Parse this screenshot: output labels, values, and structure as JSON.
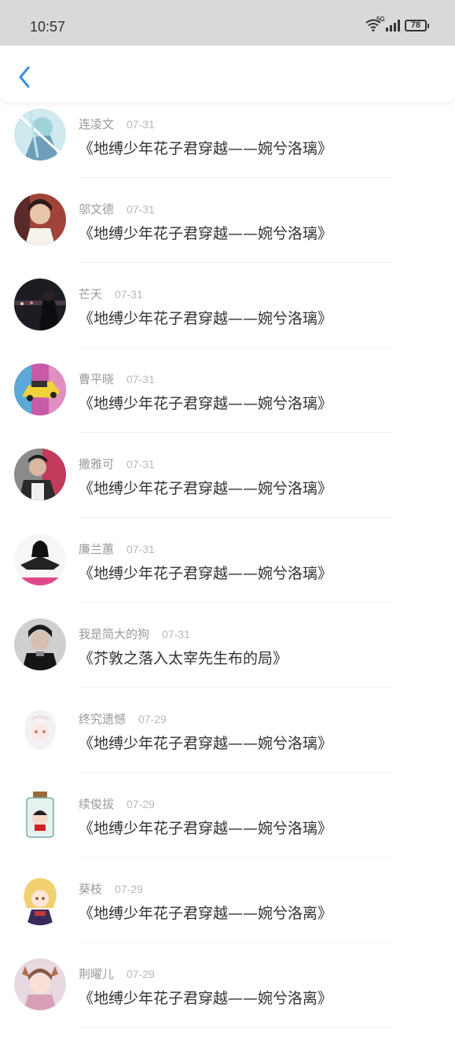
{
  "status": {
    "time": "10:57",
    "network": "5G",
    "battery": "78"
  },
  "nav": {
    "back_icon": "chevron-left-icon",
    "accent": "#3a8ee6"
  },
  "items": [
    {
      "name": "连凌文",
      "date": "07-31",
      "title": "《地缚少年花子君穿越——婉兮洛璃》"
    },
    {
      "name": "邬文德",
      "date": "07-31",
      "title": "《地缚少年花子君穿越——婉兮洛璃》"
    },
    {
      "name": "芒天",
      "date": "07-31",
      "title": "《地缚少年花子君穿越——婉兮洛璃》"
    },
    {
      "name": "曹平晓",
      "date": "07-31",
      "title": "《地缚少年花子君穿越——婉兮洛璃》"
    },
    {
      "name": "撒雅可",
      "date": "07-31",
      "title": "《地缚少年花子君穿越——婉兮洛璃》"
    },
    {
      "name": "廉兰蕙",
      "date": "07-31",
      "title": "《地缚少年花子君穿越——婉兮洛璃》"
    },
    {
      "name": "我是简大的狗",
      "date": "07-31",
      "title": "《芥敦之落入太宰先生布的局》"
    },
    {
      "name": "终究遗憾",
      "date": "07-29",
      "title": "《地缚少年花子君穿越——婉兮洛璃》"
    },
    {
      "name": "续俊拔",
      "date": "07-29",
      "title": "《地缚少年花子君穿越——婉兮洛璃》"
    },
    {
      "name": "葵枝",
      "date": "07-29",
      "title": "《地缚少年花子君穿越——婉兮洛离》"
    },
    {
      "name": "荆曜儿",
      "date": "07-29",
      "title": "《地缚少年花子君穿越——婉兮洛离》"
    }
  ]
}
